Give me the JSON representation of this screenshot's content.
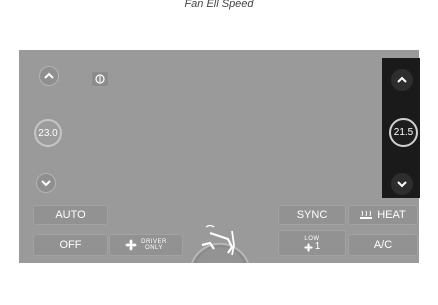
{
  "caption": "Fan Ell Speed",
  "left_zone": {
    "temperature": "23.0"
  },
  "right_zone": {
    "temperature": "21.5"
  },
  "buttons": {
    "auto": "AUTO",
    "off": "OFF",
    "driver_only_line1": "DRIVER",
    "driver_only_line2": "ONLY",
    "sync": "SYNC",
    "heat": "HEAT",
    "fan_speed_label": "LOW",
    "fan_speed_value": "1",
    "ac": "A/C"
  }
}
